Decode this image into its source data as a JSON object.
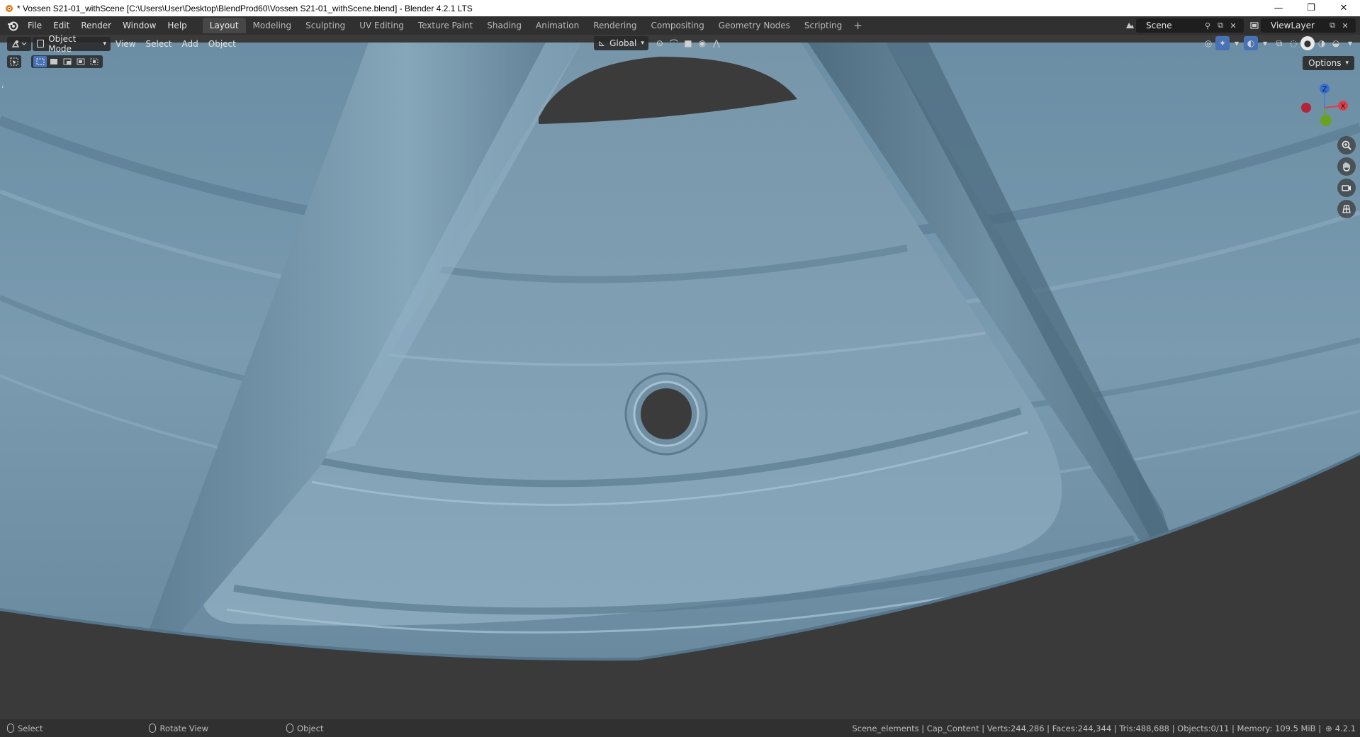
{
  "window": {
    "title": "* Vossen S21-01_withScene [C:\\Users\\User\\Desktop\\BlendProd60\\Vossen S21-01_withScene.blend] - Blender 4.2.1 LTS",
    "minimize": "—",
    "maximize": "❐",
    "close": "✕"
  },
  "menu": [
    "File",
    "Edit",
    "Render",
    "Window",
    "Help"
  ],
  "workspaces": [
    {
      "label": "Layout",
      "active": true
    },
    {
      "label": "Modeling",
      "active": false
    },
    {
      "label": "Sculpting",
      "active": false
    },
    {
      "label": "UV Editing",
      "active": false
    },
    {
      "label": "Texture Paint",
      "active": false
    },
    {
      "label": "Shading",
      "active": false
    },
    {
      "label": "Animation",
      "active": false
    },
    {
      "label": "Rendering",
      "active": false
    },
    {
      "label": "Compositing",
      "active": false
    },
    {
      "label": "Geometry Nodes",
      "active": false
    },
    {
      "label": "Scripting",
      "active": false
    }
  ],
  "workspace_add": "+",
  "scene": {
    "label": "Scene",
    "viewlayer": "ViewLayer"
  },
  "viewport_header": {
    "mode": "Object Mode",
    "menus": [
      "View",
      "Select",
      "Add",
      "Object"
    ],
    "transform_orientation": "Global",
    "options_label": "Options"
  },
  "gizmo": {
    "z": "Z",
    "x": "X"
  },
  "statusbar": {
    "select": "Select",
    "rotate": "Rotate View",
    "object": "Object",
    "stats": "Scene_elements | Cap_Content | Verts:244,286 | Faces:244,344 | Tris:488,688 | Objects:0/11 | Memory: 109.5 MiB |",
    "version": "4.2.1"
  },
  "colors": {
    "accent": "#4772b3",
    "surface": "#7190a3",
    "background": "#3a3a3a"
  }
}
